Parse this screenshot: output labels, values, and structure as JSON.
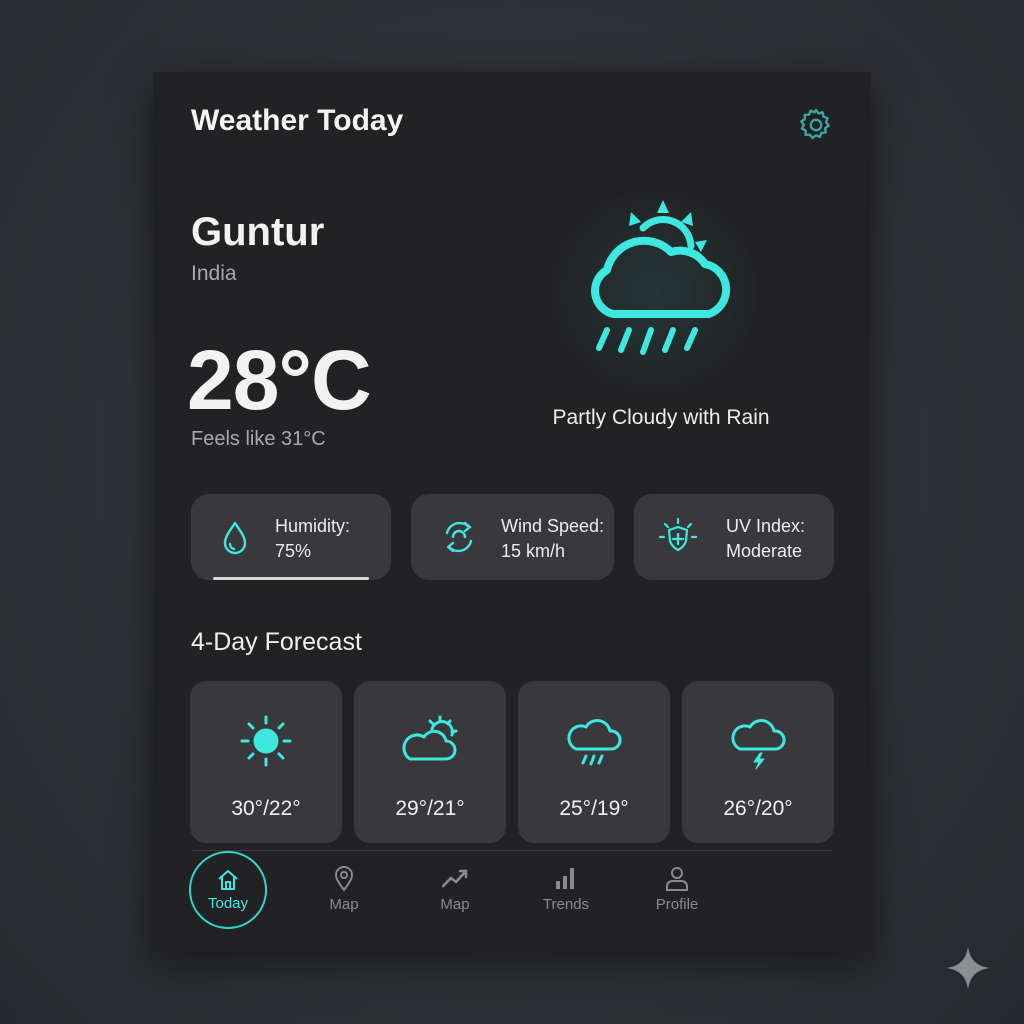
{
  "header": {
    "title": "Weather Today",
    "settings_icon": "gear-icon"
  },
  "location": {
    "city": "Guntur",
    "country": "India"
  },
  "current": {
    "temperature": "28°C",
    "feels_like": "Feels like 31°C",
    "condition": "Partly Cloudy with Rain",
    "icon": "cloud-sun-rain-icon"
  },
  "stats": [
    {
      "label": "Humidity:",
      "value": "75%",
      "icon": "water-drop-icon",
      "progress": 0.75
    },
    {
      "label": "Wind Speed:",
      "value": "15 km/h",
      "icon": "wind-cycle-icon"
    },
    {
      "label": "UV Index:",
      "value": "Moderate",
      "icon": "uv-shield-icon"
    }
  ],
  "forecast": {
    "title": "4-Day Forecast",
    "days": [
      {
        "temps": "30°/22°",
        "icon": "sun-icon"
      },
      {
        "temps": "29°/21°",
        "icon": "cloud-sun-icon"
      },
      {
        "temps": "25°/19°",
        "icon": "cloud-rain-icon"
      },
      {
        "temps": "26°/20°",
        "icon": "cloud-lightning-icon"
      }
    ]
  },
  "nav": [
    {
      "label": "Today",
      "icon": "home-icon",
      "active": true
    },
    {
      "label": "Map",
      "icon": "map-pin-icon"
    },
    {
      "label": "Map",
      "icon": "trend-icon"
    },
    {
      "label": "Trends",
      "icon": "bar-chart-icon"
    },
    {
      "label": "Profile",
      "icon": "user-icon"
    }
  ],
  "colors": {
    "accent": "#3de8e0",
    "background": "#222224",
    "card": "#39393d",
    "page": "#2e3135"
  }
}
